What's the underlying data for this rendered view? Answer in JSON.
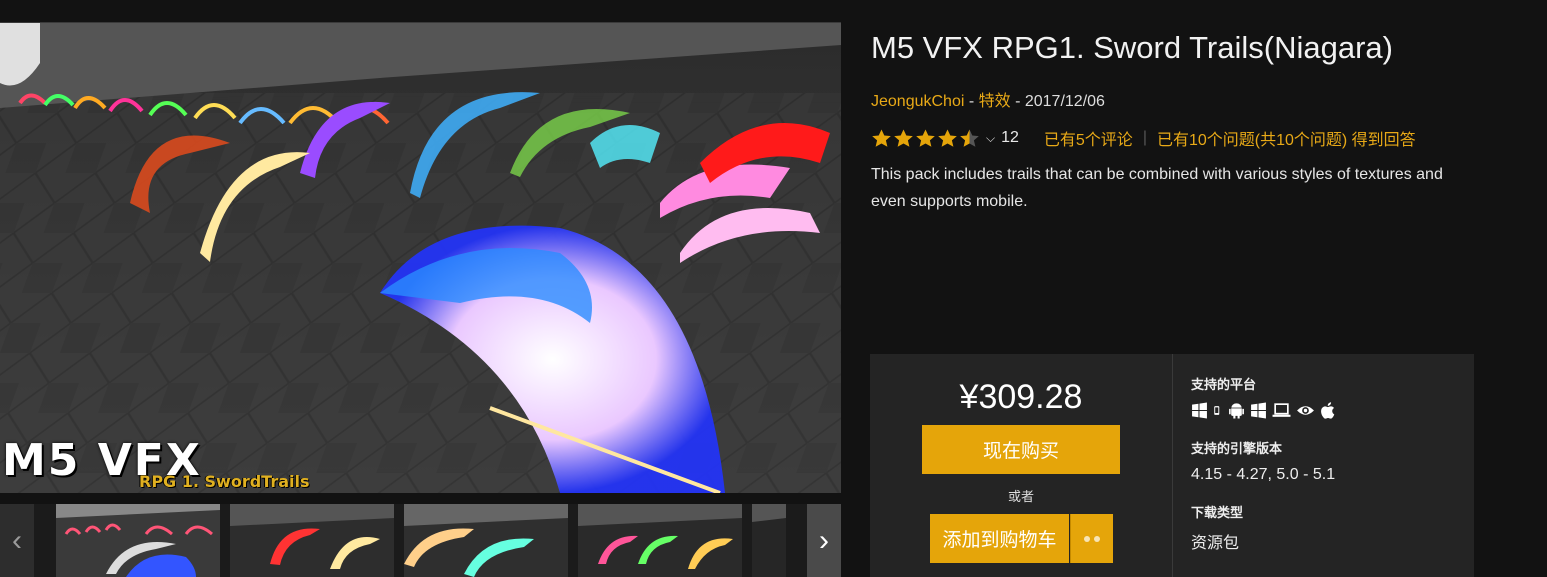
{
  "product": {
    "title": "M5 VFX RPG1. Sword Trails(Niagara)",
    "author": "JeongukChoi",
    "category": "特效",
    "date": "2017/12/06",
    "sep1": " - ",
    "sep2": " - ",
    "rating": 4.5,
    "rating_count": "12",
    "reviews_link": "已有5个评论",
    "questions_link": "已有10个问题(共10个问题) 得到回答",
    "description": "This pack includes trails that can be combined with various styles of textures and even supports mobile."
  },
  "hero": {
    "overlay_title": "M5 VFX",
    "overlay_subtitle": "RPG 1. SwordTrails"
  },
  "gallery": {
    "prev_icon": "chevron-left-icon",
    "next_icon": "chevron-right-icon",
    "prev_glyph": "‹",
    "next_glyph": "›"
  },
  "purchase": {
    "price": "¥309.28",
    "buy_label": "现在购买",
    "or_label": "或者",
    "cart_label": "添加到购物车",
    "platforms_label": "支持的平台",
    "platforms": [
      "windows-icon",
      "mobile-icon",
      "android-icon",
      "windows-icon",
      "laptop-icon",
      "eye-icon",
      "apple-icon"
    ],
    "engine_label": "支持的引擎版本",
    "engine_versions": "4.15 - 4.27, 5.0 - 5.1",
    "download_label": "下载类型",
    "download_type": "资源包"
  },
  "colors": {
    "accent": "#e5a50a",
    "link": "#e8a917",
    "background": "#121212",
    "panel": "#242424"
  }
}
